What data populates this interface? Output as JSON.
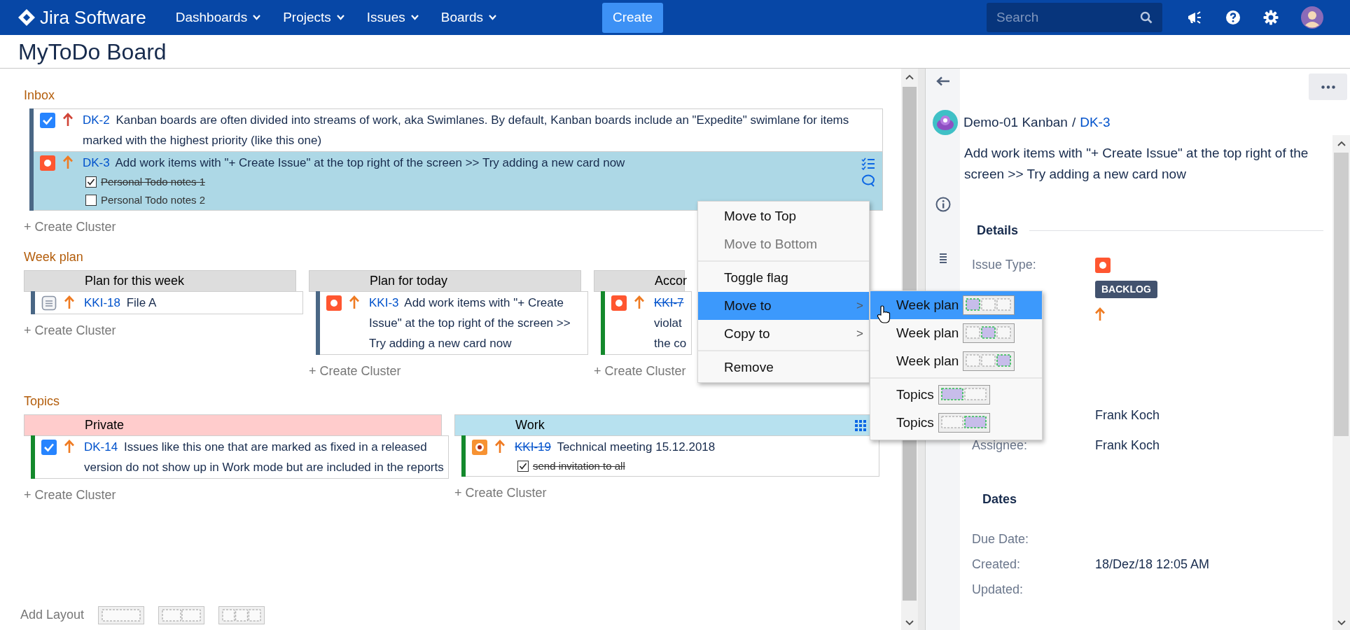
{
  "topnav": {
    "logo": "Jira Software",
    "menus": [
      "Dashboards",
      "Projects",
      "Issues",
      "Boards"
    ],
    "create": "Create",
    "search": {
      "placeholder": "Search"
    }
  },
  "board_title": "MyToDo Board",
  "sections": [
    {
      "title": "Inbox",
      "kind": "single",
      "columns": [
        {
          "cards": [
            {
              "key": "DK-2",
              "icons": [
                {
                  "kind": "done"
                },
                {
                  "kind": "arrow",
                  "color": "#d04437"
                }
              ],
              "color": "#4a6785",
              "resolved": false,
              "selected": false,
              "summary": "Kanban boards are often divided into streams of work, aka Swimlanes. By default, Kanban boards include an \"Expedite\" swimlane for items marked with the highest priority (like this one)"
            },
            {
              "key": "DK-3",
              "icons": [
                {
                  "kind": "bug"
                },
                {
                  "kind": "arrow",
                  "color": "#ef7b22"
                }
              ],
              "color": "#4a6785",
              "resolved": false,
              "selected": true,
              "summary": "Add work items with \"+ Create Issue\" at the top right of the screen >> Try adding a new card now",
              "subtasks": [
                {
                  "label": "Personal Todo notes 1",
                  "checked": true
                },
                {
                  "label": "Personal Todo notes 2",
                  "checked": false
                }
              ]
            }
          ],
          "create": "+ Create Cluster"
        }
      ]
    },
    {
      "title": "Week plan",
      "kind": "columns",
      "columns": [
        {
          "header": "Plan for this week",
          "color": "#dddddd",
          "cards": [
            {
              "key": "KKI-18",
              "icons": [
                {
                  "kind": "task"
                },
                {
                  "kind": "arrow",
                  "color": "#ef7b22"
                }
              ],
              "color": "#4a6785",
              "resolved": false,
              "selected": false,
              "summary": "File A"
            }
          ],
          "create": "+ Create Cluster"
        },
        {
          "header": "Plan for today",
          "color": "#dddddd",
          "cards": [
            {
              "key": "KKI-3",
              "icons": [
                {
                  "kind": "bug"
                },
                {
                  "kind": "arrow",
                  "color": "#ef7b22"
                }
              ],
              "color": "#4a6785",
              "resolved": false,
              "selected": false,
              "summary": "Add work items with \"+ Create Issue\" at the top right of the screen >> Try adding a new card now"
            }
          ],
          "create": "+ Create Cluster"
        },
        {
          "header": "Accor",
          "color": "#dddddd",
          "cards": [
            {
              "key": "KKI-7",
              "icons": [
                {
                  "kind": "bug"
                },
                {
                  "kind": "arrow",
                  "color": "#ef7b22"
                }
              ],
              "color": "#14892c",
              "resolved": true,
              "selected": false,
              "summary": "violat the co"
            }
          ],
          "create": "+ Create Cluster"
        }
      ]
    },
    {
      "title": "Topics",
      "kind": "columns",
      "columns": [
        {
          "header": "Private",
          "color": "#ffcccc",
          "cards": [
            {
              "key": "DK-14",
              "icons": [
                {
                  "kind": "done"
                },
                {
                  "kind": "arrow",
                  "color": "#ef7b22"
                }
              ],
              "color": "#14892c",
              "resolved": false,
              "selected": false,
              "summary": "Issues like this one that are marked as fixed in a released version do not show up in Work mode but are included in the reports"
            }
          ],
          "create": "+ Create Cluster"
        },
        {
          "header": "Work",
          "color": "#b7e1ef",
          "grid_icon": true,
          "cards": [
            {
              "key": "KKI-19",
              "icons": [
                {
                  "kind": "event"
                },
                {
                  "kind": "arrow",
                  "color": "#ef7b22"
                }
              ],
              "color": "#14892c",
              "resolved": true,
              "selected": false,
              "summary": "Technical meeting 15.12.2018",
              "subtasks": [
                {
                  "label": "send invitation to all",
                  "checked": true
                }
              ]
            }
          ],
          "create": "+ Create Cluster"
        }
      ]
    }
  ],
  "add_layout": {
    "label": "Add Layout",
    "options": [
      {
        "kind": "one"
      },
      {
        "kind": "two"
      },
      {
        "kind": "three"
      }
    ]
  },
  "context_menu": {
    "groups": [
      [
        {
          "label": "Move to Top",
          "disabled": false,
          "selected": false
        },
        {
          "label": "Move to Bottom",
          "disabled": true,
          "selected": false
        }
      ],
      [
        {
          "label": "Toggle flag",
          "disabled": false,
          "selected": false
        },
        {
          "label": "Move to",
          "disabled": false,
          "selected": true,
          "arrow": ">"
        },
        {
          "label": "Copy to",
          "disabled": false,
          "selected": false,
          "arrow": ">"
        }
      ],
      [
        {
          "label": "Remove",
          "disabled": false,
          "selected": false
        }
      ]
    ]
  },
  "submenu": {
    "groups": [
      [
        {
          "label": "Week plan",
          "selected": true,
          "slots": [
            {
              "selected": true
            },
            {
              "selected": false
            },
            {
              "selected": false
            }
          ]
        },
        {
          "label": "Week plan",
          "selected": false,
          "slots": [
            {
              "selected": false
            },
            {
              "selected": true
            },
            {
              "selected": false
            }
          ]
        },
        {
          "label": "Week plan",
          "selected": false,
          "slots": [
            {
              "selected": false
            },
            {
              "selected": false
            },
            {
              "selected": true
            }
          ]
        }
      ],
      [
        {
          "label": "Topics",
          "selected": false,
          "slots": [
            {
              "selected": true
            },
            {
              "selected": false
            }
          ]
        },
        {
          "label": "Topics",
          "selected": false,
          "slots": [
            {
              "selected": false
            },
            {
              "selected": true
            }
          ]
        }
      ]
    ]
  },
  "detail": {
    "project": "Demo-01 Kanban",
    "separator": "/",
    "issue_key": "DK-3",
    "summary": "Add work items with \"+ Create Issue\" at the top right of the screen >> Try adding a new card now",
    "details_heading": "Details",
    "fields": [
      {
        "label": "Issue Type:",
        "kind": "icon",
        "icon": {
          "kind": "bug"
        }
      },
      {
        "kind": "status",
        "value": "BACKLOG"
      },
      {
        "kind": "icon",
        "icon": {
          "kind": "arrow",
          "color": "#ef7b22"
        }
      },
      {
        "kind": "text",
        "value": "Frank Koch"
      },
      {
        "label": "Assignee:",
        "kind": "text",
        "value": "Frank Koch"
      }
    ],
    "dates_heading": "Dates",
    "dates": [
      {
        "label": "Due Date:"
      },
      {
        "label": "Created:",
        "value": "18/Dez/18 12:05 AM"
      },
      {
        "label": "Updated:"
      }
    ]
  }
}
